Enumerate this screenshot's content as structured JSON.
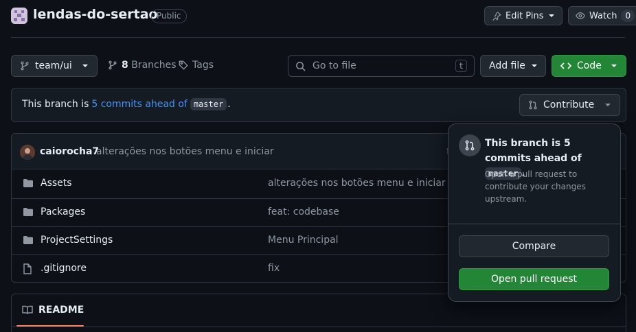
{
  "repo": {
    "name": "lendas-do-sertao",
    "visibility": "Public",
    "edit_pins_label": "Edit Pins",
    "watch_label": "Watch",
    "watch_count": "0"
  },
  "toolbar": {
    "branch_name": "team/ui",
    "branches_count": "8",
    "branches_label": "Branches",
    "tags_label": "Tags",
    "search_placeholder": "Go to file",
    "search_shortcut": "t",
    "add_file_label": "Add file",
    "code_label": "Code"
  },
  "branch_status": {
    "prefix": "This branch is",
    "ahead_link": "5 commits ahead of",
    "base_branch": "master",
    "suffix": ".",
    "contribute_label": "Contribute"
  },
  "latest_commit": {
    "author": "caiorocha7",
    "message": "alterações nos botões menu e iniciar",
    "truncated_hint": "f"
  },
  "files": [
    {
      "type": "folder",
      "name": "Assets",
      "message": "alterações nos botões menu e iniciar"
    },
    {
      "type": "folder",
      "name": "Packages",
      "message": "feat: codebase"
    },
    {
      "type": "folder",
      "name": "ProjectSettings",
      "message": "Menu Principal"
    },
    {
      "type": "file",
      "name": ".gitignore",
      "message": "fix"
    }
  ],
  "readme": {
    "label": "README"
  },
  "popover": {
    "title_line": "This branch is 5 commits ahead of",
    "title_branch": "master",
    "title_suffix": ".",
    "description": "Open a pull request to contribute your changes upstream.",
    "compare_label": "Compare",
    "open_pr_label": "Open pull request"
  },
  "colors": {
    "background": "#0d1117",
    "link": "#4493f8",
    "primary_button": "#238636",
    "readme_tab_underline": "#f78166"
  }
}
